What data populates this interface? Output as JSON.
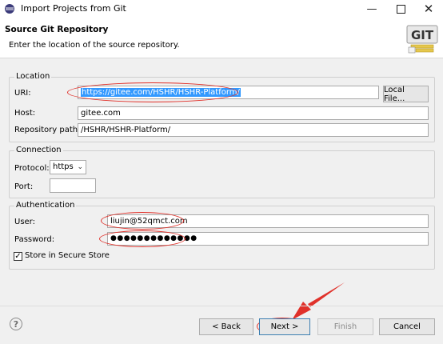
{
  "window": {
    "title": "Import Projects from Git"
  },
  "header": {
    "title": "Source Git Repository",
    "subtitle": "Enter the location of the source repository.",
    "logo_text": "GIT"
  },
  "location": {
    "group_label": "Location",
    "uri_label": "URI:",
    "uri_value": "https://gitee.com/HSHR/HSHR-Platform/",
    "local_file_button": "Local File...",
    "host_label": "Host:",
    "host_value": "gitee.com",
    "repo_path_label": "Repository path:",
    "repo_path_value": "/HSHR/HSHR-Platform/"
  },
  "connection": {
    "group_label": "Connection",
    "protocol_label": "Protocol:",
    "protocol_value": "https",
    "port_label": "Port:",
    "port_value": ""
  },
  "authentication": {
    "group_label": "Authentication",
    "user_label": "User:",
    "user_value": "liujin@52qmct.com",
    "password_label": "Password:",
    "password_value": "●●●●●●●●●●●●●",
    "store_label": "Store in Secure Store",
    "store_checked": true
  },
  "footer": {
    "back_button": "< Back",
    "next_button": "Next >",
    "finish_button": "Finish",
    "cancel_button": "Cancel"
  },
  "colors": {
    "annotation": "#e0312a",
    "selection": "#3399ff"
  }
}
